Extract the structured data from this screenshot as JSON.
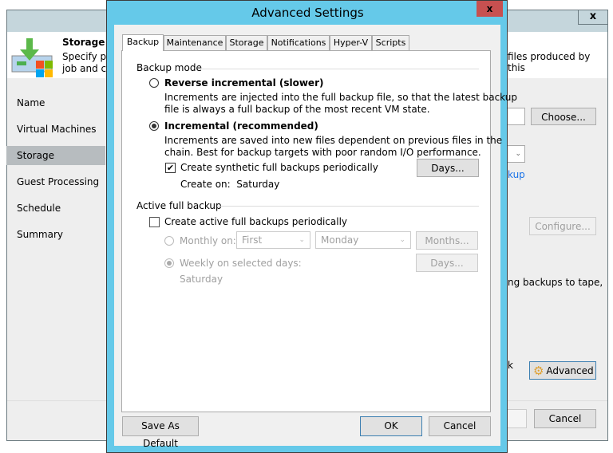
{
  "background": {
    "close_label": "x",
    "header_title": "Storage",
    "header_desc_left": "Specify pr… job and cu…",
    "header_desc_line1": "Specify pr",
    "header_desc_line2": "job and cu",
    "header_desc_right": "files produced by this",
    "nav": [
      "Name",
      "Virtual Machines",
      "Storage",
      "Guest Processing",
      "Schedule",
      "Summary"
    ],
    "choose_label": "Choose...",
    "link_fragment": "kup",
    "configure_label": "Configure...",
    "tape_text": "ng backups to tape,",
    "k_text": "k",
    "advanced_label": "Advanced",
    "cancel_label": "Cancel"
  },
  "dialog": {
    "title": "Advanced Settings",
    "close_label": "x",
    "tabs": [
      "Backup",
      "Maintenance",
      "Storage",
      "Notifications",
      "Hyper-V",
      "Scripts"
    ],
    "backup_mode_label": "Backup mode",
    "reverse_label": "Reverse incremental (slower)",
    "reverse_desc1": "Increments are injected into the full backup file, so that the latest backup",
    "reverse_desc2": "file is always a full backup of the most recent VM state.",
    "incremental_label": "Incremental (recommended)",
    "incremental_desc1": "Increments are saved into new files dependent on previous files in the",
    "incremental_desc2": "chain. Best for backup targets with poor random I/O performance.",
    "synthetic_label": "Create synthetic full backups periodically",
    "synthetic_checked": true,
    "days_label": "Days...",
    "create_on": "Create on:  Saturday",
    "active_full_label": "Active full backup",
    "active_checkbox_label": "Create active full backups periodically",
    "active_checked": false,
    "monthly_label": "Monthly on:",
    "monthly_week": "First",
    "monthly_day": "Monday",
    "months_label": "Months...",
    "weekly_label": "Weekly on selected days:",
    "weekly_days_label": "Days...",
    "weekly_value": "Saturday",
    "save_default_label": "Save As Default",
    "ok_label": "OK",
    "cancel_label": "Cancel"
  }
}
